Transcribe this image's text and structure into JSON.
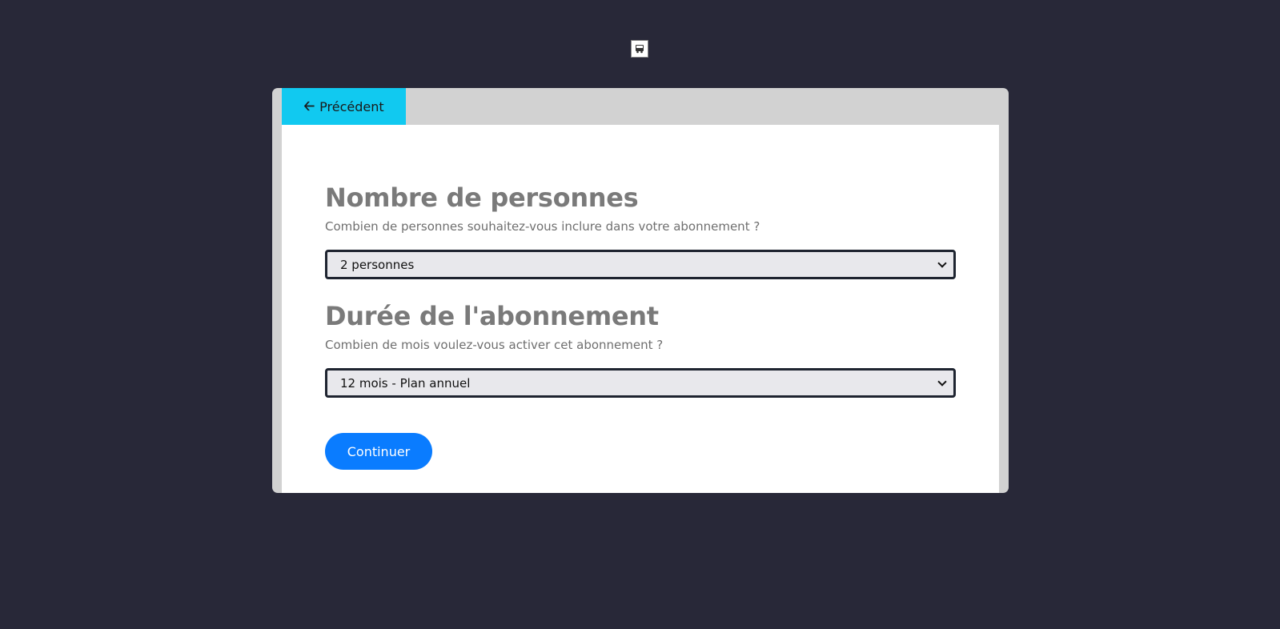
{
  "logo": {
    "icon": "bus-icon"
  },
  "nav": {
    "back_label": "Précédent",
    "back_icon": "arrow-left-icon"
  },
  "sections": [
    {
      "title": "Nombre de personnes",
      "description": "Combien de personnes souhaitez-vous inclure dans votre abonnement ?",
      "selected": "2 personnes"
    },
    {
      "title": "Durée de l'abonnement",
      "description": "Combien de mois voulez-vous activer cet abonnement ?",
      "selected": "12 mois - Plan annuel"
    }
  ],
  "actions": {
    "continue_label": "Continuer"
  },
  "colors": {
    "background": "#282838",
    "back_button": "#11c9f0",
    "continue_button": "#0a7cff",
    "card_frame": "#d2d2d2"
  }
}
